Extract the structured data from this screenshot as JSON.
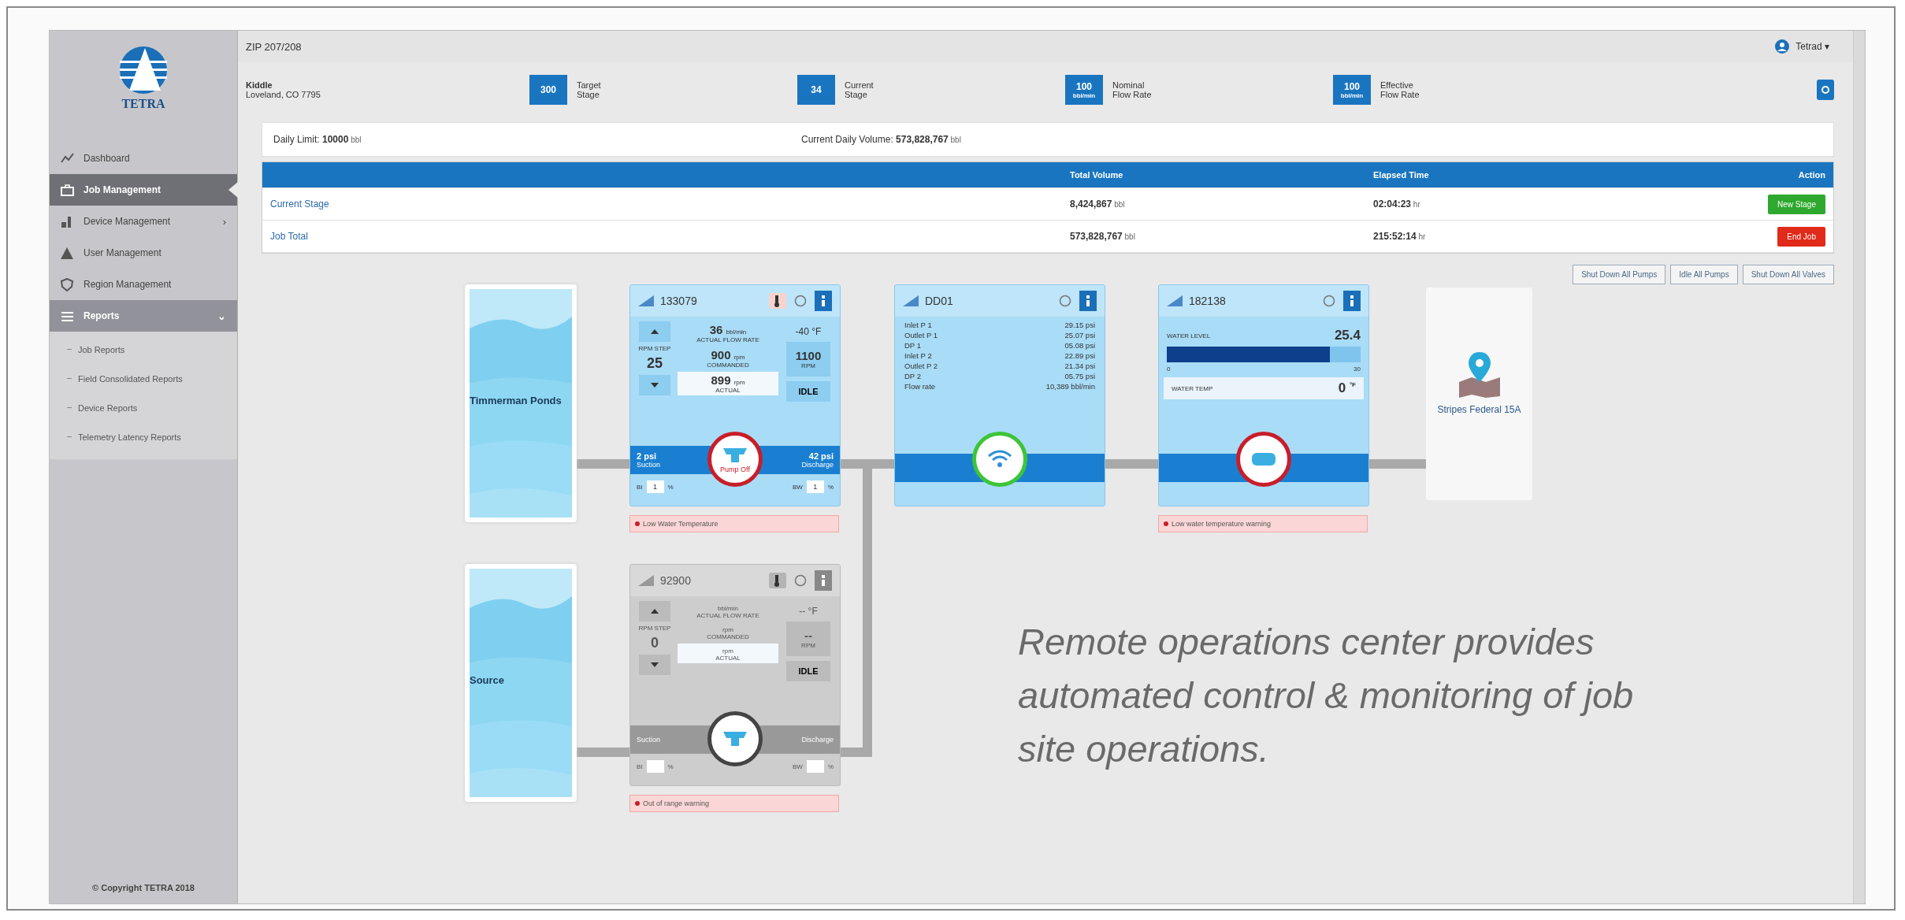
{
  "sidebar": {
    "logo_text": "TETRA",
    "items": [
      {
        "label": "Dashboard",
        "selected": false
      },
      {
        "label": "Job Management",
        "selected": true
      },
      {
        "label": "Device Management",
        "selected": false,
        "submenu": "›"
      },
      {
        "label": "User Management",
        "selected": false
      },
      {
        "label": "Region Management",
        "selected": false
      },
      {
        "label": "Reports",
        "selected": false,
        "expanded": true,
        "submenu": "⌄",
        "children": [
          {
            "label": "Job Reports"
          },
          {
            "label": "Field Consolidated Reports"
          },
          {
            "label": "Device Reports"
          },
          {
            "label": "Telemetry Latency Reports"
          }
        ]
      }
    ],
    "copyright": "© Copyright TETRA 2018"
  },
  "header": {
    "title": "ZIP 207/208",
    "user": "Tetrad",
    "user_caret": "▾"
  },
  "site": {
    "name": "Kiddle",
    "location": "Loveland, CO 7795"
  },
  "stats": [
    {
      "value": "300",
      "label_1": "Target",
      "label_2": "Stage"
    },
    {
      "value": "34",
      "label_1": "Current",
      "label_2": "Stage"
    },
    {
      "value": "100",
      "unit": "bbl/min",
      "label_1": "Nominal",
      "label_2": "Flow Rate"
    },
    {
      "value": "100",
      "unit": "bbl/min",
      "label_1": "Effective",
      "label_2": "Flow Rate"
    }
  ],
  "daily": {
    "limit_label": "Daily Limit:",
    "limit_value": "10000",
    "limit_unit": "bbl",
    "volume_label": "Current Daily Volume:",
    "volume_value": "573,828,767",
    "volume_unit": "bbl"
  },
  "table": {
    "columns": [
      "Total Volume",
      "Elapsed Time",
      "Action"
    ],
    "rows": [
      {
        "name": "Current Stage",
        "total": "8,424,867",
        "total_unit": "bbl",
        "elapsed": "02:04:23",
        "elapsed_unit": "hr",
        "action": {
          "label": "New Stage",
          "kind": "start"
        }
      },
      {
        "name": "Job Total",
        "total": "573,828,767",
        "total_unit": "bbl",
        "elapsed": "215:52:14",
        "elapsed_unit": "hr",
        "action": {
          "label": "End Job",
          "kind": "end"
        }
      }
    ]
  },
  "bulk_actions": [
    "Shut Down All Pumps",
    "Idle All Pumps",
    "Shut Down All Valves"
  ],
  "diagram": {
    "sources": [
      {
        "name": "Timmerman Ponds"
      },
      {
        "name": "Source"
      }
    ],
    "pumps": [
      {
        "id": "133079",
        "disabled": false,
        "alarm": true,
        "badge": "Pump Off",
        "temp": "-40 °F",
        "rate_value": "36",
        "rate_unit": "bbl/min",
        "rate_label": "ACTUAL FLOW RATE",
        "commanded": "900",
        "commanded_unit": "rpm",
        "commanded_label": "COMMANDED",
        "actual": "899",
        "actual_unit": "rpm",
        "actual_label": "ACTUAL",
        "step_label": "RPM STEP",
        "step": "25",
        "setpoint": "1100",
        "setpoint_label": "RPM",
        "mode": "IDLE",
        "suction": "2 psi",
        "suction_label": "Suction",
        "discharge": "42 psi",
        "discharge_label": "Discharge",
        "left_label": "BI",
        "left_value": "1",
        "right_label": "BW",
        "right_value": "1",
        "pct": "%",
        "alert": "Low Water Temperature"
      },
      {
        "id": "92900",
        "disabled": true,
        "alarm": false,
        "temp": "-- °F",
        "rate_unit": "bbl/min",
        "rate_label": "ACTUAL FLOW RATE",
        "commanded_unit": "rpm",
        "commanded_label": "COMMANDED",
        "actual_unit": "rpm",
        "actual_label": "ACTUAL",
        "step_label": "RPM STEP",
        "step": "0",
        "setpoint": "--",
        "setpoint_label": "RPM",
        "mode": "IDLE",
        "suction_label": "Suction",
        "discharge_label": "Discharge",
        "left_label": "BI",
        "right_label": "BW",
        "pct": "%",
        "alert": "Out of range warning"
      }
    ],
    "manifold": {
      "id": "DD01",
      "alarm": false,
      "rows": [
        {
          "label": "Inlet P 1",
          "value": "29.15",
          "unit": "psi"
        },
        {
          "label": "Outlet P 1",
          "value": "25.07",
          "unit": "psi"
        },
        {
          "label": "DP 1",
          "value": "05.08",
          "unit": "psi"
        },
        {
          "label": "Inlet P 2",
          "value": "22.89",
          "unit": "psi"
        },
        {
          "label": "Outlet P 2",
          "value": "21.34",
          "unit": "psi"
        },
        {
          "label": "DP 2",
          "value": "05.75",
          "unit": "psi"
        },
        {
          "label": "Flow rate",
          "value": "10,389",
          "unit": "bbl/min"
        }
      ]
    },
    "tank": {
      "id": "182138",
      "alarm": true,
      "level_label": "WATER LEVEL",
      "level_value": "25.4",
      "level": 0.84,
      "scale_min": "0",
      "scale_max": "30",
      "temp_label": "WATER TEMP",
      "temp_value": "0",
      "temp_unit": "°F",
      "alert": "Low water temperature warning"
    },
    "destination": {
      "name": "Stripes Federal 15A"
    }
  },
  "caption": "Remote operations center provides automated control & monitoring of job site operations."
}
